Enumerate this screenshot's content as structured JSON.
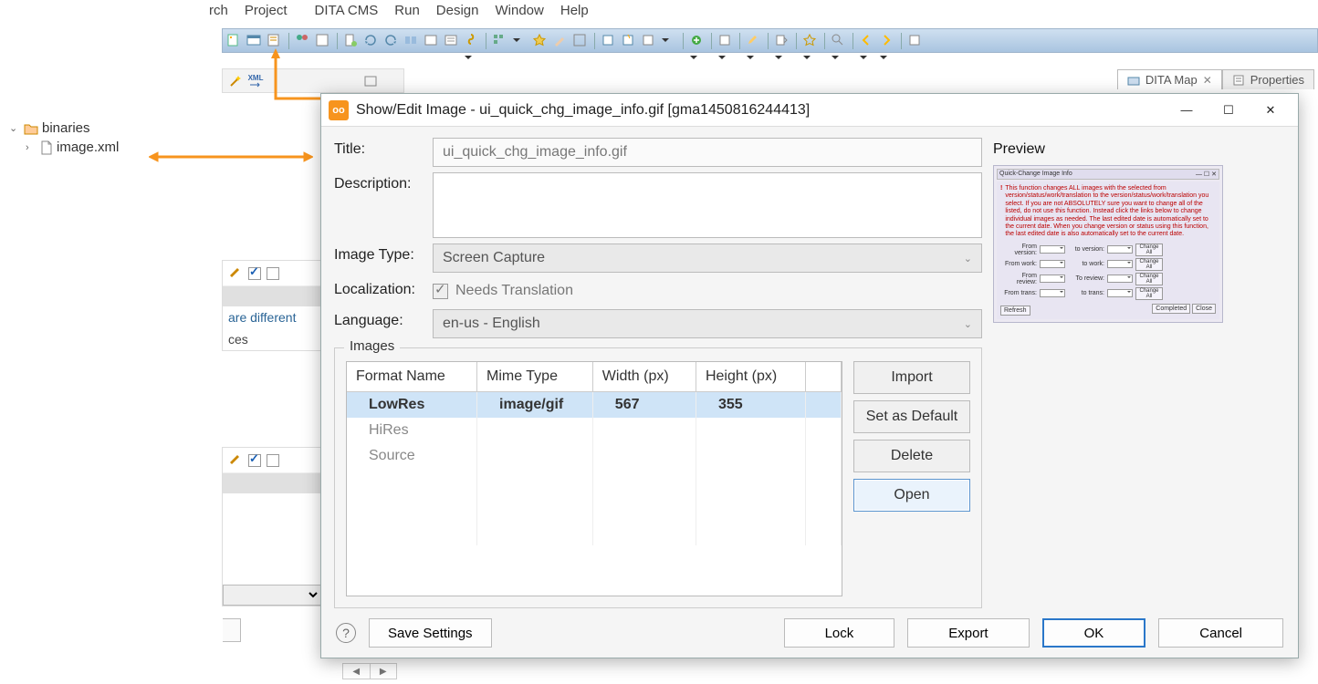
{
  "menu": {
    "items": [
      "rch",
      "Project",
      "DITA CMS",
      "Run",
      "Design",
      "Window",
      "Help"
    ]
  },
  "rightTabs": {
    "ditaMap": "DITA Map",
    "properties": "Properties"
  },
  "tree": {
    "folder": "binaries",
    "file": "image.xml"
  },
  "sideFragment": {
    "link": "are different",
    "ces": "ces"
  },
  "dialog": {
    "title": "Show/Edit Image - ui_quick_chg_image_info.gif [gma1450816244413]",
    "labels": {
      "title": "Title:",
      "description": "Description:",
      "imageType": "Image Type:",
      "localization": "Localization:",
      "language": "Language:",
      "images": "Images",
      "preview": "Preview"
    },
    "values": {
      "title": "ui_quick_chg_image_info.gif",
      "description": "",
      "imageType": "Screen Capture",
      "needsTranslation": "Needs Translation",
      "language": "en-us - English"
    },
    "table": {
      "headers": [
        "Format Name",
        "Mime Type",
        "Width (px)",
        "Height (px)"
      ],
      "rows": [
        {
          "format": "LowRes",
          "mime": "image/gif",
          "w": "567",
          "h": "355",
          "selected": true
        },
        {
          "format": "HiRes",
          "mime": "",
          "w": "",
          "h": "",
          "selected": false
        },
        {
          "format": "Source",
          "mime": "",
          "w": "",
          "h": "",
          "selected": false
        }
      ]
    },
    "buttons": {
      "import": "Import",
      "setDefault": "Set as Default",
      "delete": "Delete",
      "open": "Open",
      "saveSettings": "Save Settings",
      "lock": "Lock",
      "export": "Export",
      "ok": "OK",
      "cancel": "Cancel"
    },
    "preview": {
      "winTitle": "Quick-Change Image Info",
      "rowLabels": [
        [
          "From version:",
          "to version:"
        ],
        [
          "From work:",
          "to work:"
        ],
        [
          "From review:",
          "To review:"
        ],
        [
          "From trans:",
          "to trans:"
        ]
      ],
      "changeAll": "Change All",
      "refresh": "Refresh",
      "longbtn": "Completed",
      "close": "Close"
    }
  }
}
